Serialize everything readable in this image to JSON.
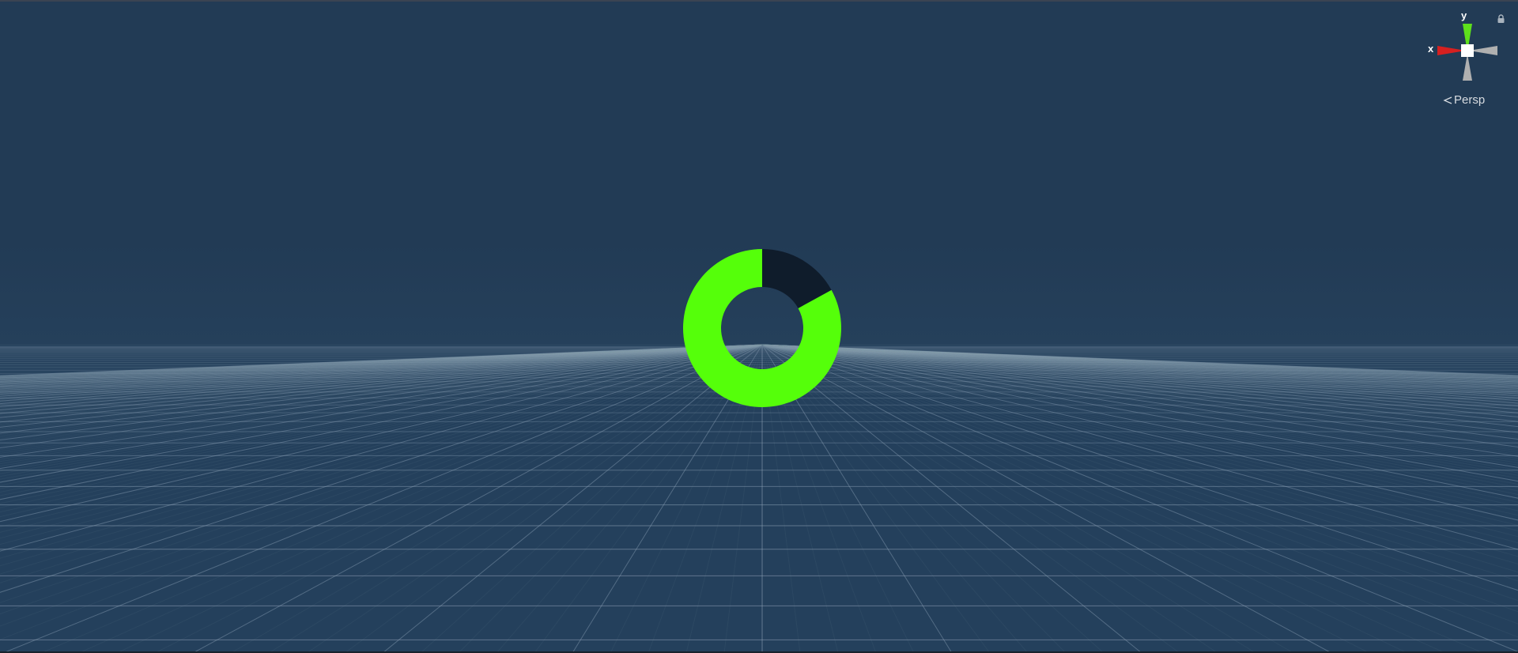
{
  "scene": {
    "colors": {
      "background": "#223b55",
      "grid_line": "#8fa3b8",
      "ring_progress": "#55ff0a",
      "ring_remaining": "#0f1c2b"
    },
    "ring": {
      "progress_fraction": 0.83
    }
  },
  "gizmo": {
    "x_label": "x",
    "y_label": "y",
    "projection_label": "Persp",
    "projection_icon": "chevron-left-icon",
    "lock_icon": "lock-icon",
    "colors": {
      "x_axis": "#d62020",
      "y_axis": "#5ee01c",
      "neutral_axis": "#a8a8a8",
      "center": "#ffffff"
    }
  }
}
